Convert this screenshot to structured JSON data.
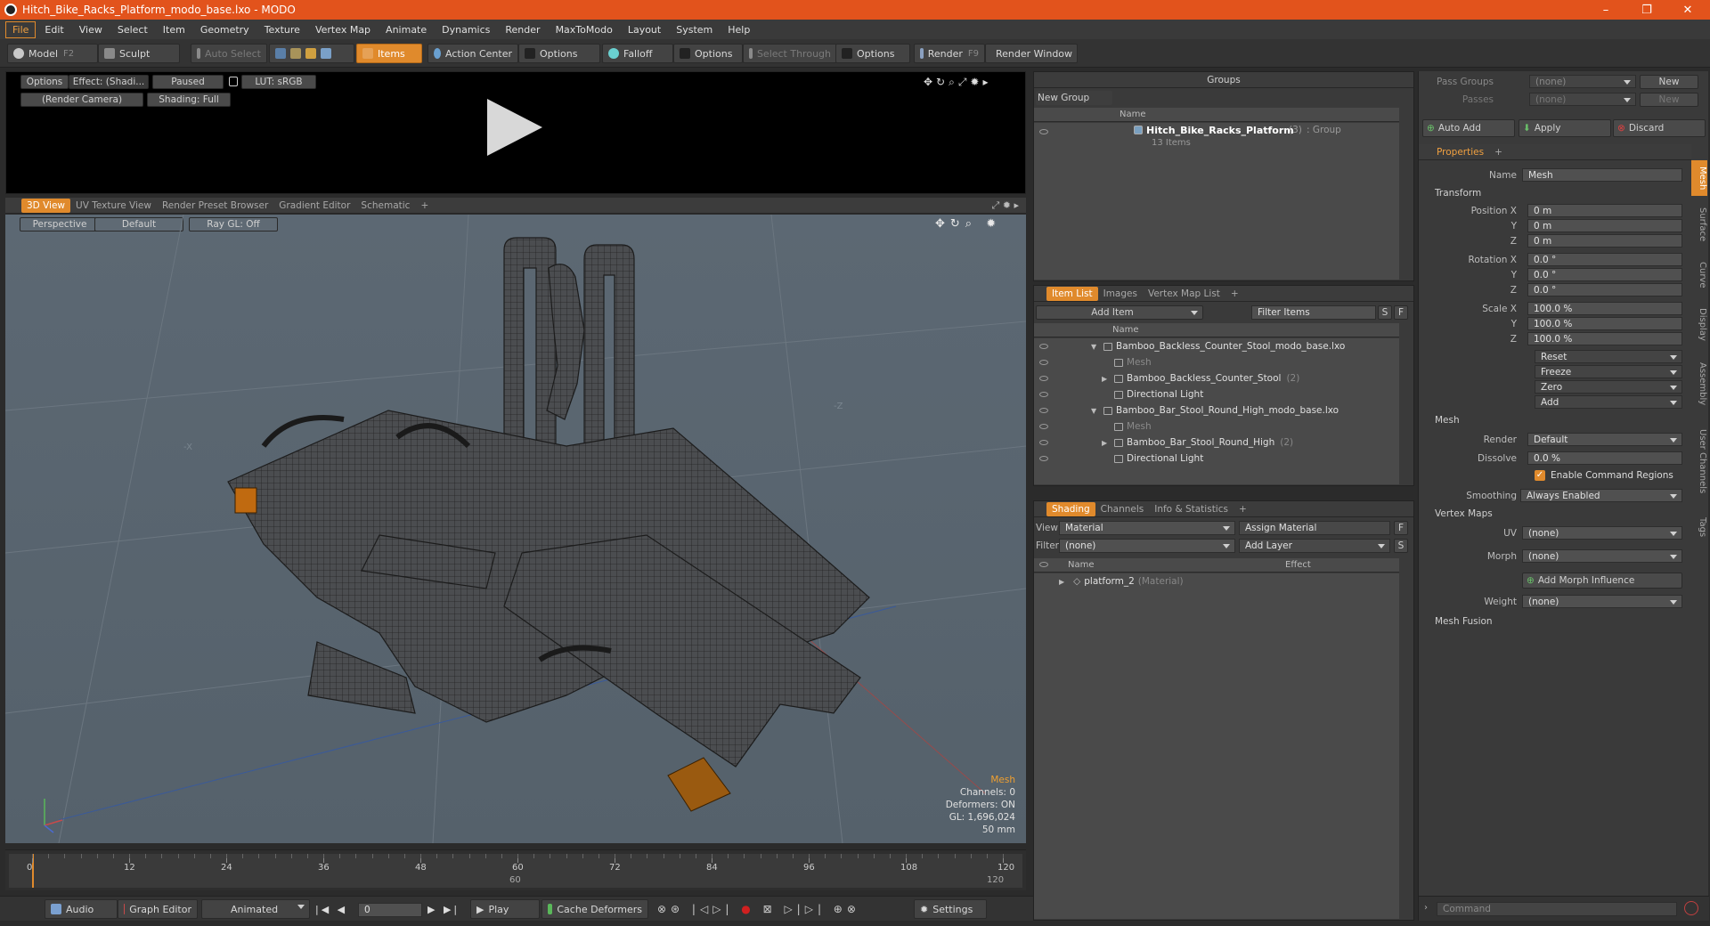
{
  "window": {
    "title": "Hitch_Bike_Racks_Platform_modo_base.lxo - MODO",
    "min": "–",
    "max": "❐",
    "close": "✕"
  },
  "menu": [
    "File",
    "Edit",
    "View",
    "Select",
    "Item",
    "Geometry",
    "Texture",
    "Vertex Map",
    "Animate",
    "Dynamics",
    "Render",
    "MaxToModo",
    "Layout",
    "System",
    "Help"
  ],
  "toolbar": {
    "model": "Model",
    "model_key": "F2",
    "sculpt": "Sculpt",
    "auto_select": "Auto Select",
    "items": "Items",
    "action_center": "Action Center",
    "options1": "Options",
    "falloff": "Falloff",
    "options2": "Options",
    "select_through": "Select Through",
    "options3": "Options",
    "render": "Render",
    "render_key": "F9",
    "render_window": "Render Window"
  },
  "preview": {
    "options": "Options",
    "effect": "Effect: (Shadi...",
    "paused": "Paused",
    "lut": "LUT: sRGB",
    "camera": "(Render Camera)",
    "shading": "Shading: Full"
  },
  "viewtabs": {
    "t1": "3D View",
    "t2": "UV Texture View",
    "t3": "Render Preset Browser",
    "t4": "Gradient Editor",
    "t5": "Schematic",
    "add": "+"
  },
  "viewport": {
    "perspective": "Perspective",
    "default": "Default",
    "raygl": "Ray GL: Off",
    "axis_x": "-X",
    "axis_z": "-Z",
    "stats": {
      "mesh": "Mesh",
      "channels": "Channels: 0",
      "deformers": "Deformers: ON",
      "gl": "GL: 1,696,024",
      "mm": "50 mm"
    }
  },
  "timeline": {
    "ticks": [
      "0",
      "12",
      "24",
      "36",
      "48",
      "60",
      "72",
      "84",
      "96",
      "108",
      "120"
    ],
    "sub60": "60",
    "sub120": "120",
    "sub120b": "120"
  },
  "transport": {
    "audio": "Audio",
    "graph_editor": "Graph Editor",
    "animated": "Animated",
    "frame": "0",
    "play": "Play",
    "cache": "Cache Deformers",
    "settings": "Settings"
  },
  "groups": {
    "title": "Groups",
    "new_group": "New Group",
    "col_name": "Name",
    "item": "Hitch_Bike_Racks_Platform",
    "count": "(3)",
    "type": ": Group",
    "sub": "13 Items"
  },
  "itemlist": {
    "tab1": "Item List",
    "tab2": "Images",
    "tab3": "Vertex Map List",
    "add": "+",
    "add_item": "Add Item",
    "filter": "Filter Items",
    "s": "S",
    "f": "F",
    "col_name": "Name",
    "rows": [
      {
        "label": "Bamboo_Backless_Counter_Stool_modo_base.lxo",
        "indent": 0,
        "arrow": "▼",
        "dim": false,
        "count": ""
      },
      {
        "label": "Mesh",
        "indent": 1,
        "arrow": "",
        "dim": true,
        "count": ""
      },
      {
        "label": "Bamboo_Backless_Counter_Stool",
        "indent": 1,
        "arrow": "▶",
        "dim": false,
        "count": "(2)"
      },
      {
        "label": "Directional Light",
        "indent": 1,
        "arrow": "",
        "dim": false,
        "count": ""
      },
      {
        "label": "Bamboo_Bar_Stool_Round_High_modo_base.lxo",
        "indent": 0,
        "arrow": "▼",
        "dim": false,
        "count": ""
      },
      {
        "label": "Mesh",
        "indent": 1,
        "arrow": "",
        "dim": true,
        "count": ""
      },
      {
        "label": "Bamboo_Bar_Stool_Round_High",
        "indent": 1,
        "arrow": "▶",
        "dim": false,
        "count": "(2)"
      },
      {
        "label": "Directional Light",
        "indent": 1,
        "arrow": "",
        "dim": false,
        "count": ""
      }
    ]
  },
  "shading": {
    "tab1": "Shading",
    "tab2": "Channels",
    "tab3": "Info & Statistics",
    "add": "+",
    "view_lbl": "View",
    "view_val": "Material",
    "assign": "Assign Material",
    "f": "F",
    "filter_lbl": "Filter",
    "filter_val": "(none)",
    "add_layer": "Add Layer",
    "s": "S",
    "col_name": "Name",
    "col_effect": "Effect",
    "item": "platform_2",
    "item_type": "(Material)"
  },
  "right": {
    "pass_groups_lbl": "Pass Groups",
    "pass_groups_val": "(none)",
    "new": "New",
    "passes_lbl": "Passes",
    "passes_val": "(none)",
    "new2": "New",
    "auto_add": "Auto Add",
    "apply": "Apply",
    "discard": "Discard",
    "prop_tab": "Properties",
    "add": "+",
    "name_lbl": "Name",
    "name_val": "Mesh",
    "transform": "Transform",
    "pos_lbl": "Position X",
    "y": "Y",
    "z": "Z",
    "pos": [
      "0 m",
      "0 m",
      "0 m"
    ],
    "rot_lbl": "Rotation X",
    "rot": [
      "0.0 °",
      "0.0 °",
      "0.0 °"
    ],
    "scale_lbl": "Scale X",
    "scale": [
      "100.0 %",
      "100.0 %",
      "100.0 %"
    ],
    "reset": "Reset",
    "freeze": "Freeze",
    "zero": "Zero",
    "addbtn": "Add",
    "mesh_sect": "Mesh",
    "render_lbl": "Render",
    "render_val": "Default",
    "dissolve_lbl": "Dissolve",
    "dissolve_val": "0.0 %",
    "ecr": "Enable Command Regions",
    "smoothing_lbl": "Smoothing",
    "smoothing_val": "Always Enabled",
    "vmaps": "Vertex Maps",
    "uv_lbl": "UV",
    "uv_val": "(none)",
    "morph_lbl": "Morph",
    "morph_val": "(none)",
    "add_morph": "Add Morph Influence",
    "weight_lbl": "Weight",
    "weight_val": "(none)",
    "mesh_fusion": "Mesh Fusion",
    "vtabs": [
      "Mesh",
      "Surface",
      "Curve",
      "Display",
      "Assembly",
      "User Channels",
      "Tags"
    ],
    "command": "Command"
  },
  "colors": {
    "accent": "#e08a2c",
    "titlebar": "#e2531c"
  }
}
